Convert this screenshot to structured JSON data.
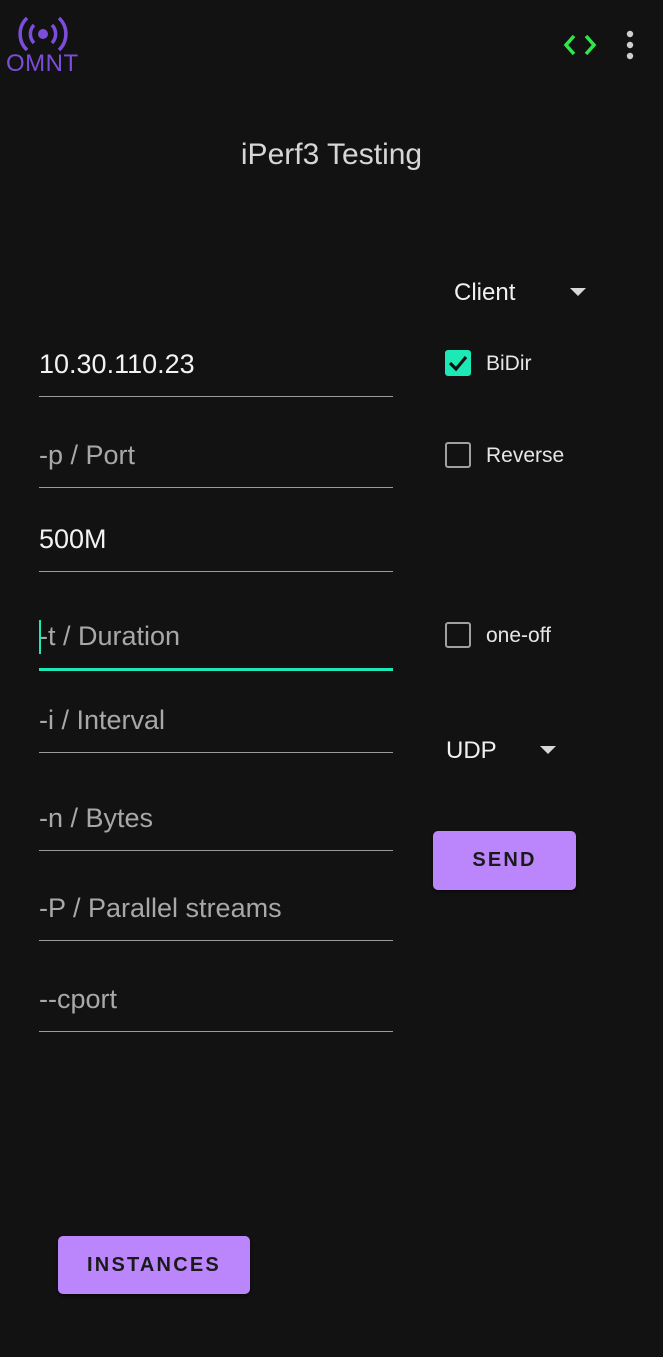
{
  "app": {
    "logo_text": "OMNT",
    "title": "iPerf3 Testing",
    "accent_color": "#bb86fc",
    "focus_color": "#1de9b6",
    "toolbar_icons": [
      "code-icon",
      "more-vert-icon"
    ]
  },
  "mode_dropdown": {
    "selected": "Client"
  },
  "protocol_dropdown": {
    "selected": "UDP"
  },
  "fields": {
    "host": {
      "value": "10.30.110.23",
      "placeholder": ""
    },
    "port": {
      "value": "",
      "placeholder": "-p / Port"
    },
    "bandwidth": {
      "value": "500M",
      "placeholder": ""
    },
    "duration": {
      "value": "",
      "placeholder": "-t / Duration"
    },
    "interval": {
      "value": "",
      "placeholder": "-i / Interval"
    },
    "bytes": {
      "value": "",
      "placeholder": "-n / Bytes"
    },
    "parallel": {
      "value": "",
      "placeholder": "-P / Parallel streams"
    },
    "cport": {
      "value": "",
      "placeholder": "--cport"
    }
  },
  "options": {
    "bidir": {
      "label": "BiDir",
      "checked": true
    },
    "reverse": {
      "label": "Reverse",
      "checked": false
    },
    "oneoff": {
      "label": "one-off",
      "checked": false
    }
  },
  "buttons": {
    "send": "SEND",
    "instances": "INSTANCES"
  }
}
